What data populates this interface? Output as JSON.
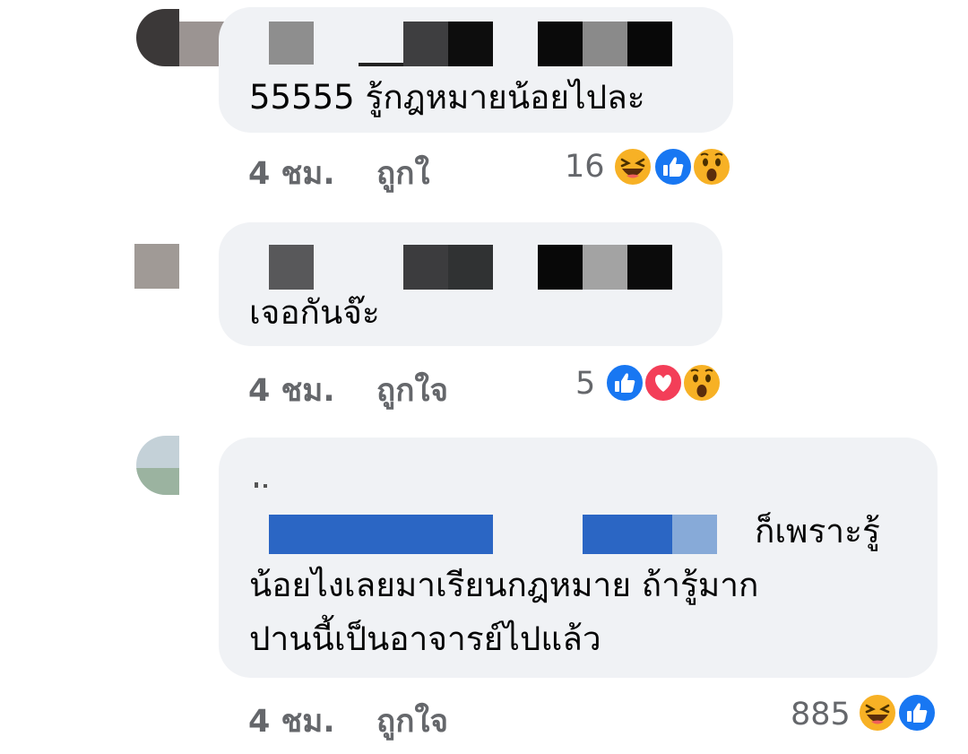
{
  "comments": [
    {
      "text_lines": [
        "55555 รู้กฎหมายน้อยไปละ"
      ],
      "time": "4 ชม.",
      "like_label": "ถูกใ",
      "reaction_count": "16",
      "reaction_icons": [
        "haha-icon",
        "like-icon",
        "wow-icon"
      ]
    },
    {
      "text_lines": [
        "เจอกันจ๊ะ"
      ],
      "time": "4 ชม.",
      "like_label": "ถูกใจ",
      "reaction_count": "5",
      "reaction_icons": [
        "like-icon",
        "love-icon",
        "wow-icon"
      ]
    },
    {
      "text_lines": [
        "ก็เพราะรู้",
        "น้อยไงเลยมาเรียนกฎหมาย ถ้ารู้มาก",
        "ปานนี้เป็นอาจารย์ไปแล้ว"
      ],
      "time": "4 ชม.",
      "like_label": "ถูกใจ",
      "reaction_count": "885",
      "reaction_icons": [
        "haha-icon",
        "like-icon"
      ]
    }
  ],
  "colors": {
    "bubble": "#f0f2f5",
    "meta_text": "#65676b",
    "like_blue": "#1877f2",
    "love_red": "#f33e58",
    "emoji_yellow": "#f7b125",
    "redaction_blue": "#2b66c4"
  }
}
